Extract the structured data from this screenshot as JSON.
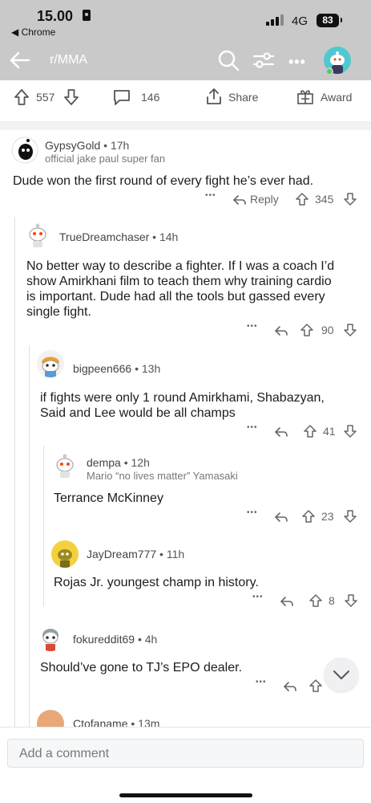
{
  "status": {
    "time": "15.00",
    "back_app": "◀ Chrome",
    "network": "4G",
    "battery": "83"
  },
  "nav": {
    "subreddit": "r/MMA"
  },
  "post_actions": {
    "upvotes": "557",
    "comments": "146",
    "share": "Share",
    "award": "Award"
  },
  "comments": [
    {
      "user": "GypsyGold",
      "age": "17h",
      "flair": "official jake paul super fan",
      "body": "Dude won the first round of every fight he’s ever had.",
      "more": "•••",
      "reply": "Reply",
      "score": "345"
    },
    {
      "user": "TrueDreamchaser",
      "age": "14h",
      "body_lines": [
        "No better way to describe a fighter. If I was a coach I’d",
        "show Amirkhani film to teach them why training cardio",
        "is important. Dude had all the tools but gassed every",
        "single fight."
      ],
      "more": "•••",
      "score": "90"
    },
    {
      "user": "bigpeen666",
      "age": "13h",
      "body_lines": [
        "if fights were only 1 round Amirkhami, Shabazyan,",
        "Said and Lee would be all champs"
      ],
      "more": "•••",
      "score": "41"
    },
    {
      "user": "dempa",
      "age": "12h",
      "flair": "Mario “no lives matter” Yamasaki",
      "body": "Terrance McKinney",
      "more": "•••",
      "score": "23"
    },
    {
      "user": "JayDream777",
      "age": "11h",
      "body": "Rojas Jr. youngest champ in history.",
      "more": "•••",
      "score": "8"
    },
    {
      "user": "fokureddit69",
      "age": "4h",
      "body": "Should’ve gone to TJ’s EPO dealer.",
      "more": "•••"
    },
    {
      "user": "Ctofaname",
      "age": "13m"
    }
  ],
  "compose": {
    "placeholder": "Add a comment"
  },
  "colors": {
    "header_bg": "#c9c9c9",
    "avatar_teal": "#50c8d0",
    "online": "#46d160"
  }
}
